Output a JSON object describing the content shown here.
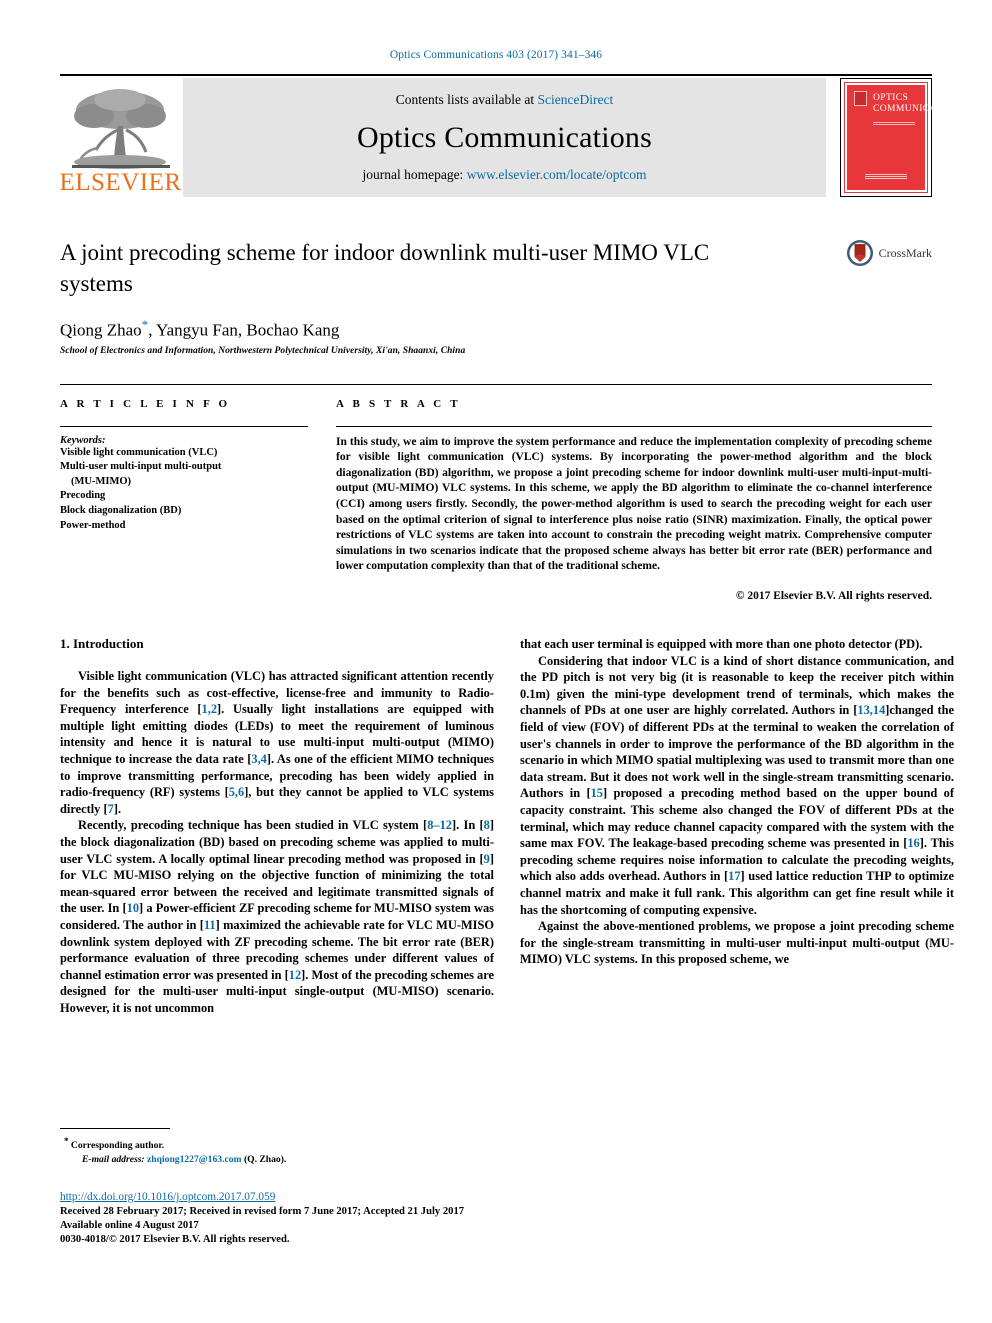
{
  "running_head": "Optics Communications 403 (2017) 341–346",
  "masthead": {
    "publisher_name": "ELSEVIER",
    "contents_prefix": "Contents lists available at ",
    "contents_link": "ScienceDirect",
    "journal_title": "Optics Communications",
    "homepage_prefix": "journal homepage: ",
    "homepage_link": "www.elsevier.com/locate/optcom",
    "cover_title_line1": "OPTICS",
    "cover_title_line2": "COMMUNICATIONS"
  },
  "article": {
    "title": "A joint precoding scheme for indoor downlink multi-user MIMO VLC systems",
    "crossmark_label": "CrossMark",
    "authors": "Qiong Zhao",
    "authors_rest": ", Yangyu Fan, Bochao Kang",
    "affiliation": "School of Electronics and Information, Northwestern Polytechnical University, Xi'an, Shaanxi, China"
  },
  "info": {
    "heading": "A R T I C L E    I N F O",
    "keywords_label": "Keywords:",
    "keywords": [
      "Visible light communication (VLC)",
      "Multi-user multi-input multi-output",
      "(MU-MIMO)",
      "Precoding",
      "Block diagonalization (BD)",
      "Power-method"
    ]
  },
  "abstract": {
    "heading": "A B S T R A C T",
    "text": "In this study, we aim to improve the system performance and reduce the implementation complexity of precoding scheme for visible light communication (VLC) systems. By incorporating the power-method algorithm and the block diagonalization (BD) algorithm, we propose a joint precoding scheme for indoor downlink multi-user multi-input-multi-output (MU-MIMO) VLC systems. In this scheme, we apply the BD algorithm to eliminate the co-channel interference (CCI) among users firstly. Secondly, the power-method algorithm is used to search the precoding weight for each user based on the optimal criterion of signal to interference plus noise ratio (SINR) maximization. Finally, the optical power restrictions of VLC systems are taken into account to constrain the precoding weight matrix. Comprehensive computer simulations in two scenarios indicate that the proposed scheme always has better bit error rate (BER) performance and lower computation complexity than that of the traditional scheme.",
    "copyright": "© 2017 Elsevier B.V. All rights reserved."
  },
  "body": {
    "section_title": "1.  Introduction",
    "left_paragraphs": [
      "Visible light communication (VLC) has attracted significant attention recently for the benefits such as cost-effective, license-free and immunity to Radio-Frequency interference [1,2]. Usually light installations are equipped with multiple light emitting diodes (LEDs) to meet the requirement of luminous intensity and hence it is natural to use multi-input multi-output (MIMO) technique to increase the data rate [3,4]. As one of the efficient MIMO techniques to improve transmitting performance, precoding has been widely applied in radio-frequency (RF) systems [5,6], but they cannot be applied to VLC systems directly [7].",
      "Recently, precoding technique has been studied in VLC system [8–12]. In [8] the block diagonalization (BD) based on precoding scheme was applied to multi-user VLC system. A locally optimal linear precoding method was proposed in [9] for VLC MU-MISO relying on the objective function of minimizing the total mean-squared error between the received and legitimate transmitted signals of the user. In [10] a Power-efficient ZF precoding scheme for MU-MISO system was considered. The author in [11] maximized the achievable rate for VLC MU-MISO downlink system deployed with ZF precoding scheme. The bit error rate (BER) performance evaluation of three precoding schemes under different values of channel estimation error was presented in [12]. Most of the precoding schemes are designed for the multi-user multi-input single-output (MU-MISO) scenario. However, it is not uncommon"
    ],
    "right_paragraphs": [
      "that each user terminal is equipped with more than one photo detector (PD).",
      "Considering that indoor VLC is a kind of short distance communication, and the PD pitch is not very big (it is reasonable to keep the receiver pitch within 0.1m) given the mini-type development trend of terminals, which makes the channels of PDs at one user are highly correlated. Authors in [13,14]changed the field of view (FOV) of different PDs at the terminal to weaken the correlation of user's channels in order to improve the performance of the BD algorithm in the scenario in which MIMO spatial multiplexing was used to transmit more than one data stream. But it does not work well in the single-stream transmitting scenario. Authors in [15] proposed a precoding method based on the upper bound of capacity constraint. This scheme also changed the FOV of different PDs at the terminal, which may reduce channel capacity compared with the system with the same max FOV. The leakage-based precoding scheme was presented in [16]. This precoding scheme requires noise information to calculate the precoding weights, which also adds overhead. Authors in [17] used lattice reduction THP to optimize channel matrix and make it full rank. This algorithm can get fine result while it has the shortcoming of computing expensive.",
      "Against the above-mentioned problems, we propose a joint precoding scheme for the single-stream transmitting in multi-user multi-input multi-output (MU-MIMO) VLC systems. In this proposed scheme, we"
    ]
  },
  "footnote": {
    "corresponding": "Corresponding author.",
    "email_label": "E-mail address:",
    "email": "zhqiong1227@163.com",
    "email_suffix": "(Q. Zhao)."
  },
  "footer": {
    "doi": "http://dx.doi.org/10.1016/j.optcom.2017.07.059",
    "received": "Received 28 February 2017; Received in revised form 7 June 2017; Accepted 21 July 2017",
    "available": "Available online 4 August 2017",
    "issn_copyright": "0030-4018/© 2017 Elsevier B.V. All rights reserved."
  },
  "colors": {
    "link": "#0b6aa2",
    "elsevier_orange": "#E9711C",
    "cover_red": "#e8373a",
    "band_gray": "#e4e4e4"
  }
}
